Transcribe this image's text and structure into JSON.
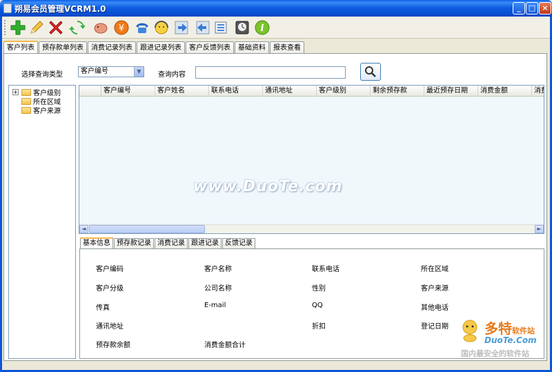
{
  "window": {
    "title": "朔易会员管理VCRM1.0",
    "buttons": [
      "_",
      "□",
      "×"
    ]
  },
  "toolbar": {
    "icons": [
      "add-icon",
      "edit-pencil-icon",
      "delete-icon",
      "refresh-icon",
      "piggy-bank-icon",
      "yen-icon",
      "phone-icon",
      "support-headset-icon",
      "forward-arrow-icon",
      "back-arrow-icon",
      "database-icon",
      "backup-clock-icon",
      "info-icon"
    ]
  },
  "tabs": [
    "客户列表",
    "预存款单列表",
    "消费记录列表",
    "跟进记录列表",
    "客户反馈列表",
    "基础资料",
    "报表查看"
  ],
  "query": {
    "type_label": "选择查询类型",
    "type_value": "客户编号",
    "content_label": "查询内容",
    "content_value": ""
  },
  "tree": [
    "客户级别",
    "所在区域",
    "客户来源"
  ],
  "grid": {
    "columns": [
      "客户编号",
      "客户姓名",
      "联系电话",
      "通讯地址",
      "客户级别",
      "剩余预存款",
      "最近预存日期",
      "消费金额",
      "消费"
    ]
  },
  "detail_tabs": [
    "基本信息",
    "预存款记录",
    "消费记录",
    "跟进记录",
    "反馈记录"
  ],
  "detail_fields": [
    [
      "客户编码",
      "客户名称",
      "联系电话",
      "所在区域"
    ],
    [
      "客户分级",
      "公司名称",
      "性别",
      "客户来源"
    ],
    [
      "传真",
      "E-mail",
      "QQ",
      "其他电话"
    ],
    [
      "通讯地址",
      "",
      "折扣",
      "登记日期"
    ],
    [
      "预存款余额",
      "消费金额合计",
      "",
      ""
    ]
  ],
  "watermark": "www.DuoTe.com",
  "logo": {
    "brand": "多特",
    "brand_suffix": "软件站",
    "domain": "DuoTe.Com",
    "slogan": "国内最安全的软件站"
  }
}
